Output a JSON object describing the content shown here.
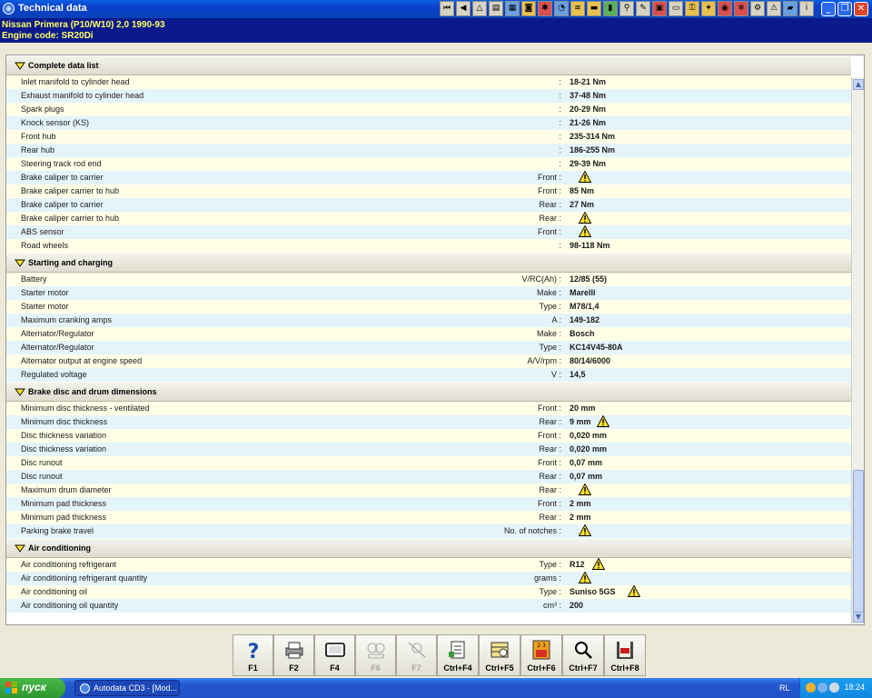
{
  "window": {
    "title": "Technical data"
  },
  "vehicle": {
    "line1": "Nissan   Primera (P10/W10) 2,0  1990-93",
    "line2": "Engine code: SR20Di"
  },
  "sections": [
    {
      "title": "Complete data list",
      "rows": [
        {
          "label": "Inlet manifold to cylinder head",
          "qual": ":",
          "value": "18-21 Nm",
          "warn": false
        },
        {
          "label": "Exhaust manifold to cylinder head",
          "qual": ":",
          "value": "37-48 Nm",
          "warn": false
        },
        {
          "label": "Spark plugs",
          "qual": ":",
          "value": "20-29 Nm",
          "warn": false
        },
        {
          "label": "Knock sensor (KS)",
          "qual": ":",
          "value": "21-26 Nm",
          "warn": false
        },
        {
          "label": "Front hub",
          "qual": ":",
          "value": "235-314 Nm",
          "warn": false
        },
        {
          "label": "Rear hub",
          "qual": ":",
          "value": "186-255 Nm",
          "warn": false
        },
        {
          "label": "Steering track rod end",
          "qual": ":",
          "value": "29-39 Nm",
          "warn": false
        },
        {
          "label": "Brake caliper to carrier",
          "qual": "Front :",
          "value": "",
          "warn": true
        },
        {
          "label": "Brake caliper carrier to hub",
          "qual": "Front :",
          "value": "85 Nm",
          "warn": false
        },
        {
          "label": "Brake caliper to carrier",
          "qual": "Rear :",
          "value": "27 Nm",
          "warn": false
        },
        {
          "label": "Brake caliper carrier to hub",
          "qual": "Rear :",
          "value": "",
          "warn": true
        },
        {
          "label": "ABS sensor",
          "qual": "Front :",
          "value": "",
          "warn": true
        },
        {
          "label": "Road wheels",
          "qual": ":",
          "value": "98-118 Nm",
          "warn": false
        }
      ]
    },
    {
      "title": "Starting and charging",
      "rows": [
        {
          "label": "Battery",
          "qual": "V/RC(Ah) :",
          "value": "12/85 (55)",
          "warn": false
        },
        {
          "label": "Starter motor",
          "qual": "Make :",
          "value": "Marelli",
          "warn": false
        },
        {
          "label": "Starter motor",
          "qual": "Type :",
          "value": "M78/1,4",
          "warn": false
        },
        {
          "label": "Maximum cranking amps",
          "qual": "A :",
          "value": "149-182",
          "warn": false
        },
        {
          "label": "Alternator/Regulator",
          "qual": "Make :",
          "value": "Bosch",
          "warn": false
        },
        {
          "label": "Alternator/Regulator",
          "qual": "Type :",
          "value": "KC14V45-80A",
          "warn": false
        },
        {
          "label": "Alternator output at engine speed",
          "qual": "A/V/rpm :",
          "value": "80/14/6000",
          "warn": false
        },
        {
          "label": "Regulated voltage",
          "qual": "V :",
          "value": "14,5",
          "warn": false
        }
      ]
    },
    {
      "title": "Brake disc and drum dimensions",
      "rows": [
        {
          "label": "Minimum disc thickness - ventilated",
          "qual": "Front :",
          "value": "20 mm",
          "warn": false
        },
        {
          "label": "Minimum disc thickness",
          "qual": "Rear :",
          "value": "9 mm",
          "warn": true
        },
        {
          "label": "Disc thickness variation",
          "qual": "Front :",
          "value": "0,020 mm",
          "warn": false
        },
        {
          "label": "Disc thickness variation",
          "qual": "Rear :",
          "value": "0,020 mm",
          "warn": false
        },
        {
          "label": "Disc runout",
          "qual": "Front :",
          "value": "0,07 mm",
          "warn": false
        },
        {
          "label": "Disc runout",
          "qual": "Rear :",
          "value": "0,07 mm",
          "warn": false
        },
        {
          "label": "Maximum drum diameter",
          "qual": "Rear :",
          "value": "",
          "warn": true
        },
        {
          "label": "Minimum pad thickness",
          "qual": "Front :",
          "value": "2 mm",
          "warn": false
        },
        {
          "label": "Minimum pad thickness",
          "qual": "Rear :",
          "value": "2 mm",
          "warn": false
        },
        {
          "label": "Parking brake travel",
          "qual": "No. of notches :",
          "value": "",
          "warn": true
        }
      ]
    },
    {
      "title": "Air conditioning",
      "rows": [
        {
          "label": "Air conditioning refrigerant",
          "qual": "Type :",
          "value": "R12",
          "warn": true
        },
        {
          "label": "Air conditioning refrigerant quantity",
          "qual": "grams :",
          "value": "",
          "warn": true
        },
        {
          "label": "Air conditioning oil",
          "qual": "Type :",
          "value": "Suniso 5GS",
          "warn": true
        },
        {
          "label": "Air conditioning oil quantity",
          "qual": "cm³ :",
          "value": "200",
          "warn": false
        }
      ]
    }
  ],
  "fkeys": [
    {
      "label": "F1",
      "icon": "help-icon",
      "enabled": true
    },
    {
      "label": "F2",
      "icon": "print-icon",
      "enabled": true
    },
    {
      "label": "F4",
      "icon": "screen-icon",
      "enabled": true
    },
    {
      "label": "F6",
      "icon": "diagram-icon",
      "enabled": false
    },
    {
      "label": "F7",
      "icon": "tools-icon",
      "enabled": false
    },
    {
      "label": "Ctrl+F4",
      "icon": "notes-icon",
      "enabled": true
    },
    {
      "label": "Ctrl+F5",
      "icon": "chart-icon",
      "enabled": true
    },
    {
      "label": "Ctrl+F6",
      "icon": "calendar-icon",
      "enabled": true
    },
    {
      "label": "Ctrl+F7",
      "icon": "search-icon",
      "enabled": true
    },
    {
      "label": "Ctrl+F8",
      "icon": "lift-icon",
      "enabled": true
    }
  ],
  "taskbar": {
    "start_label": "пуск",
    "task_label": "Autodata CD3 - [Mod...",
    "lang": "RL",
    "clock": "18:24"
  }
}
